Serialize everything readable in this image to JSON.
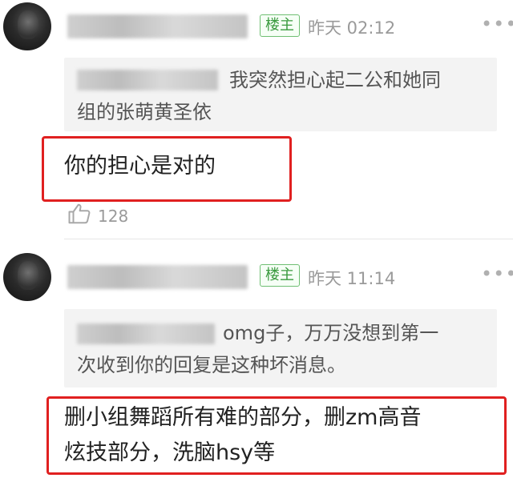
{
  "comments": [
    {
      "badge": "楼主",
      "time": "昨天 02:12",
      "more": "•••",
      "quote_line1": "我突然担心起二公和她同",
      "quote_line2": "组的张萌黄圣依",
      "reply": "你的担心是对的",
      "like_count": "128"
    },
    {
      "badge": "楼主",
      "time": "昨天 11:14",
      "more": "•••",
      "quote_line1": "omg子，万万没想到第一",
      "quote_line2": "次收到你的回复是这种坏消息。",
      "reply_line1": "删小组舞蹈所有难的部分，删zm高音",
      "reply_line2": "炫技部分，洗脑hsy等"
    }
  ]
}
